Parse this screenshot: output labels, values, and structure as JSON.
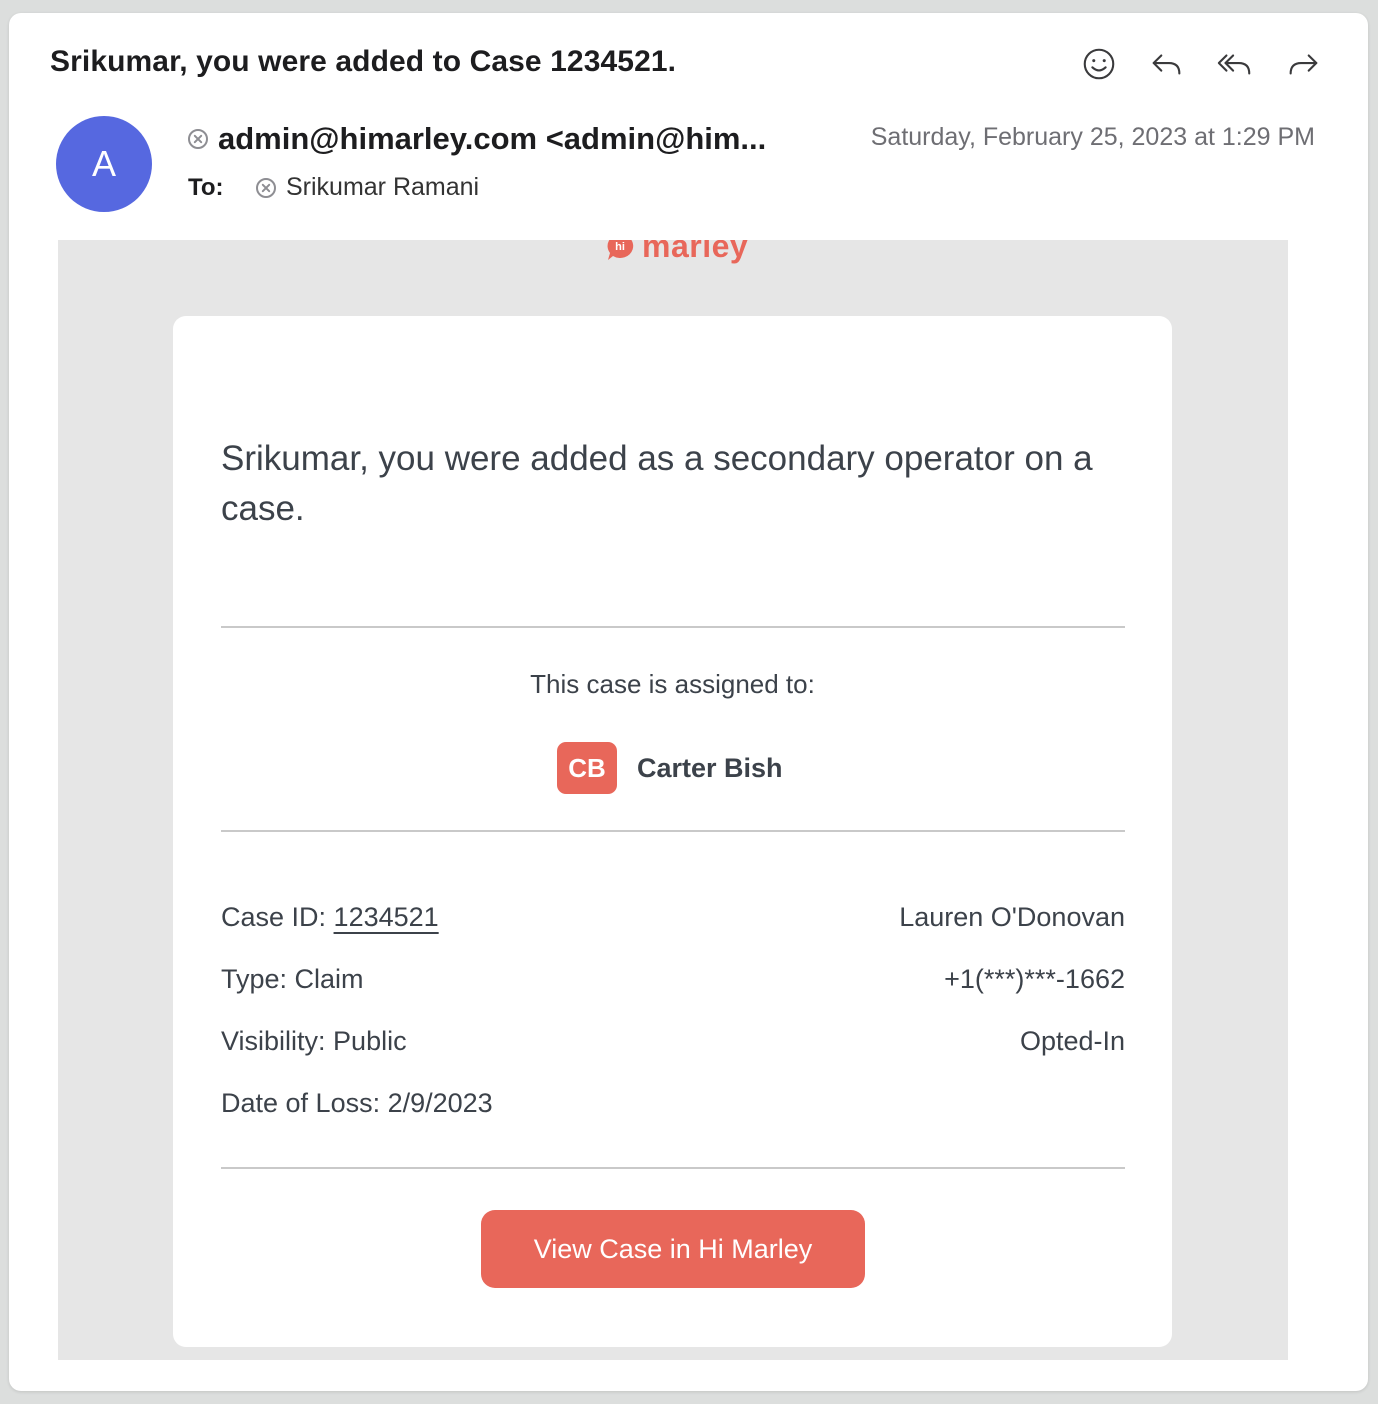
{
  "email": {
    "subject": "Srikumar, you were added to Case 1234521.",
    "sender_initial": "A",
    "from": "admin@himarley.com <admin@him...",
    "date": "Saturday, February 25, 2023 at 1:29 PM",
    "to_label": "To:",
    "to_name": "Srikumar Ramani"
  },
  "toolbar": {
    "icons": [
      "smiley-icon",
      "reply-icon",
      "reply-all-icon",
      "forward-icon"
    ]
  },
  "body": {
    "logo_badge": "hi",
    "logo_text": "marley",
    "headline": "Srikumar, you were added as a secondary operator on a case.",
    "assigned_label": "This case is assigned to:",
    "assignee_initials": "CB",
    "assignee_name": "Carter Bish",
    "details_left": [
      {
        "label": "Case ID: ",
        "value": "1234521"
      },
      {
        "label": "Type: ",
        "value": "Claim"
      },
      {
        "label": "Visibility: ",
        "value": "Public"
      },
      {
        "label": "Date of Loss: ",
        "value": "2/9/2023"
      }
    ],
    "details_right": [
      "Lauren O'Donovan",
      "+1(***)***-1662",
      "Opted-In"
    ],
    "button_label": "View Case in Hi Marley"
  },
  "colors": {
    "brand": "#e8675a",
    "avatar": "#5668e0",
    "body_bg": "#e6e6e6",
    "text": "#3c424a"
  }
}
